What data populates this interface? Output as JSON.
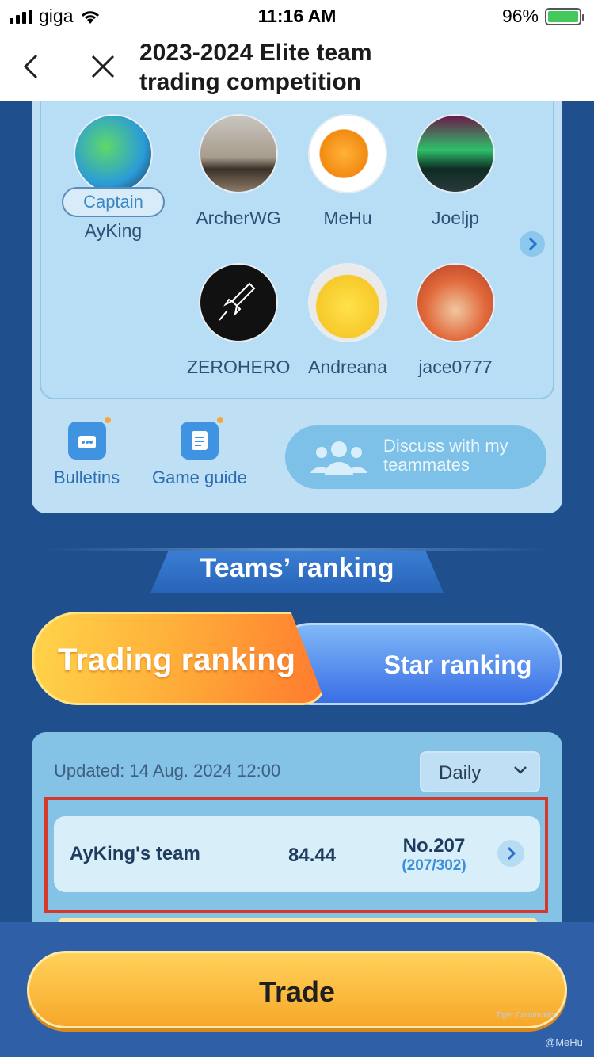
{
  "status_bar": {
    "carrier": "giga",
    "time": "11:16 AM",
    "battery": "96%"
  },
  "header": {
    "title": "2023-2024 Elite team trading competition"
  },
  "team": {
    "captain_label": "Captain",
    "members": [
      {
        "name": "AyKing",
        "captain": true
      },
      {
        "name": "ArcherWG"
      },
      {
        "name": "MeHu"
      },
      {
        "name": "Joeljp"
      },
      {
        "name": "ZEROHERO"
      },
      {
        "name": "Andreana"
      },
      {
        "name": "jace0777"
      }
    ]
  },
  "tools": {
    "bulletins": "Bulletins",
    "game_guide": "Game guide",
    "discuss": "Discuss with my teammates"
  },
  "ranking": {
    "section_title": "Teams’ ranking",
    "tab_trading": "Trading ranking",
    "tab_star": "Star ranking",
    "updated": "Updated: 14 Aug. 2024 12:00",
    "period": "Daily",
    "row": {
      "team": "AyKing's team",
      "score": "84.44",
      "rank": "No.207",
      "rank_detail": "(207/302)"
    }
  },
  "bottom": {
    "trade_label": "Trade",
    "watermark": "Tiger Community",
    "watermark_user": "@MeHu"
  },
  "colors": {
    "accent": "#3c8ed8",
    "highlight_box": "#d33a2c",
    "trade_button": "#f6a82a"
  }
}
